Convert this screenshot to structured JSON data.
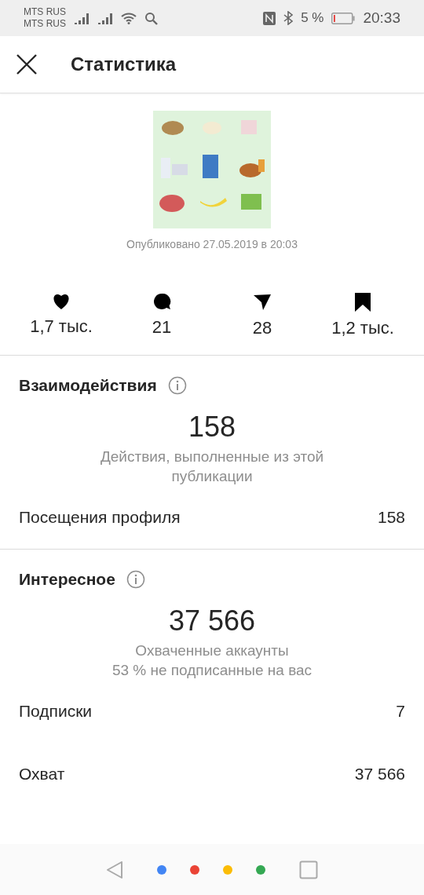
{
  "status_bar": {
    "carriers": [
      "MTS RUS",
      "MTS RUS"
    ],
    "battery": "5 %",
    "time": "20:33"
  },
  "header": {
    "title": "Статистика"
  },
  "post": {
    "kind": "picture",
    "published": "Опубликовано 27.05.2019 в 20:03"
  },
  "stats": [
    {
      "kind": "likes",
      "value": "1,7 тыс."
    },
    {
      "kind": "comments",
      "value": "21"
    },
    {
      "kind": "shares",
      "value": "28"
    },
    {
      "kind": "saves",
      "value": "1,2 тыс."
    }
  ],
  "sections": [
    {
      "title": "Взаимодействия",
      "total": "158",
      "description": [
        "Действия, выполненные из этой публикации"
      ],
      "rows": [
        {
          "label": "Посещения профиля",
          "value": "158"
        }
      ]
    },
    {
      "title": "Интересное",
      "total": "37 566",
      "description": [
        "Охваченные аккаунты",
        "53 % не подписанные на вас"
      ],
      "rows": [
        {
          "label": "Подписки",
          "value": "7"
        },
        {
          "label": "Охват",
          "value": "37 566"
        }
      ]
    }
  ],
  "nav_dots": [
    {
      "color": "#4285f4"
    },
    {
      "color": "#ea4335"
    },
    {
      "color": "#fbbc05"
    },
    {
      "color": "#34a853"
    }
  ]
}
